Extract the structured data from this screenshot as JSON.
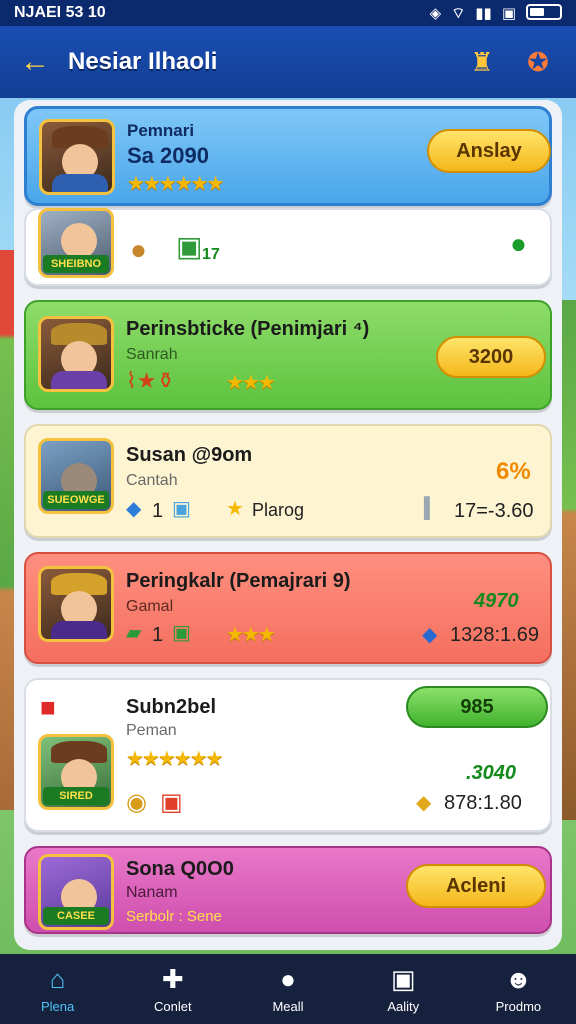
{
  "status_bar": {
    "time": "NJAEI 53 10"
  },
  "header": {
    "title": "Nesiar Ilhaoli"
  },
  "cards": [
    {
      "name": "Pemnari",
      "score": "Sa 2090",
      "button": "Anslay",
      "stars": "★★★★★★"
    },
    {
      "tag": "SHEIBNO",
      "value_badge": "17"
    },
    {
      "name": "Perinsbticke (Penimjari ⁴)",
      "sub": "Sanrah",
      "stars": "★★★",
      "pill": "3200",
      "tag": ""
    },
    {
      "name": "Susan @9om",
      "sub": "Cantah",
      "stat1": "1",
      "action": "Plarog",
      "percent": "6%",
      "value": "17=-3.60",
      "tag": "SUEOWGE"
    },
    {
      "name": "Peringkalr (Pemajrari 9)",
      "sub": "Gamal",
      "stat1": "1",
      "stars": "★★★",
      "score": "4970",
      "value": "1328:1.69"
    },
    {
      "name": "Subn2bel",
      "sub": "Peman",
      "stars": "★★★★★★",
      "pill": "985",
      "score": ".3040",
      "value": "878:1.80",
      "tag": "SIRED"
    },
    {
      "name": "Sona Q0O0",
      "sub": "Nanam",
      "line": "Serbolr : Sene",
      "button": "Acleni",
      "tag": "CASEE"
    }
  ],
  "nav": [
    {
      "label": "Plena",
      "icon": "home-icon"
    },
    {
      "label": "Conlet",
      "icon": "puzzle-icon"
    },
    {
      "label": "Meall",
      "icon": "trophy-icon"
    },
    {
      "label": "Aality",
      "icon": "chest-icon"
    },
    {
      "label": "Prodmo",
      "icon": "profile-icon"
    }
  ]
}
